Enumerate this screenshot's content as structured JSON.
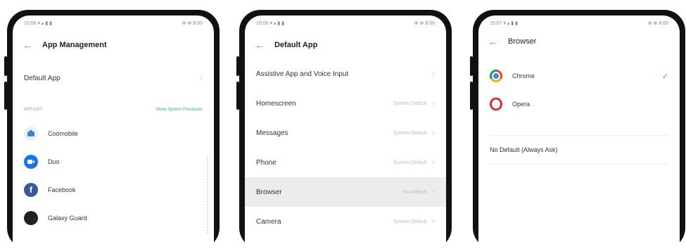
{
  "status_bar": {
    "left_1": "10:06 ▾ ▴ ▮ ▮",
    "right_1": "⊕ ⊗ 8:00",
    "left_2": "10:06 ▾ ▴ ▮ ▮",
    "right_2": "⊕ ⊗ 8:00",
    "left_3": "10:07 ▾ ▴ ▮ ▮",
    "right_3": "⊕ ⊗ 8:00"
  },
  "screen1": {
    "title": "App Management",
    "default_app_label": "Default App",
    "section_left": "APP LIST",
    "section_right": "Show System Processes",
    "apps": [
      {
        "name": "Coomobile",
        "icon": "coomobile-icon",
        "color": "#3f7fd6"
      },
      {
        "name": "Duo",
        "icon": "duo-icon",
        "color": "#1a73e8"
      },
      {
        "name": "Facebook",
        "icon": "facebook-icon",
        "color": "#3b5998"
      },
      {
        "name": "Galaxy Guard",
        "icon": "guard-icon",
        "color": "#222222"
      }
    ]
  },
  "screen2": {
    "title": "Default App",
    "rows": [
      {
        "label": "Assistive App and Voice Input",
        "value": ""
      },
      {
        "label": "Homescreen",
        "value": "System Default"
      },
      {
        "label": "Messages",
        "value": "System Default"
      },
      {
        "label": "Phone",
        "value": "System Default"
      },
      {
        "label": "Browser",
        "value": "No Default"
      },
      {
        "label": "Camera",
        "value": "System Default"
      }
    ]
  },
  "screen3": {
    "title": "Browser",
    "options": [
      {
        "name": "Chrome",
        "selected": true,
        "icon": "chrome-icon"
      },
      {
        "name": "Opera",
        "selected": false,
        "icon": "opera-icon"
      }
    ],
    "no_default": "No Default (Always Ask)",
    "check_glyph": "✓"
  },
  "colors": {
    "accent": "#2bb39a",
    "highlight_row": "#ececec"
  }
}
